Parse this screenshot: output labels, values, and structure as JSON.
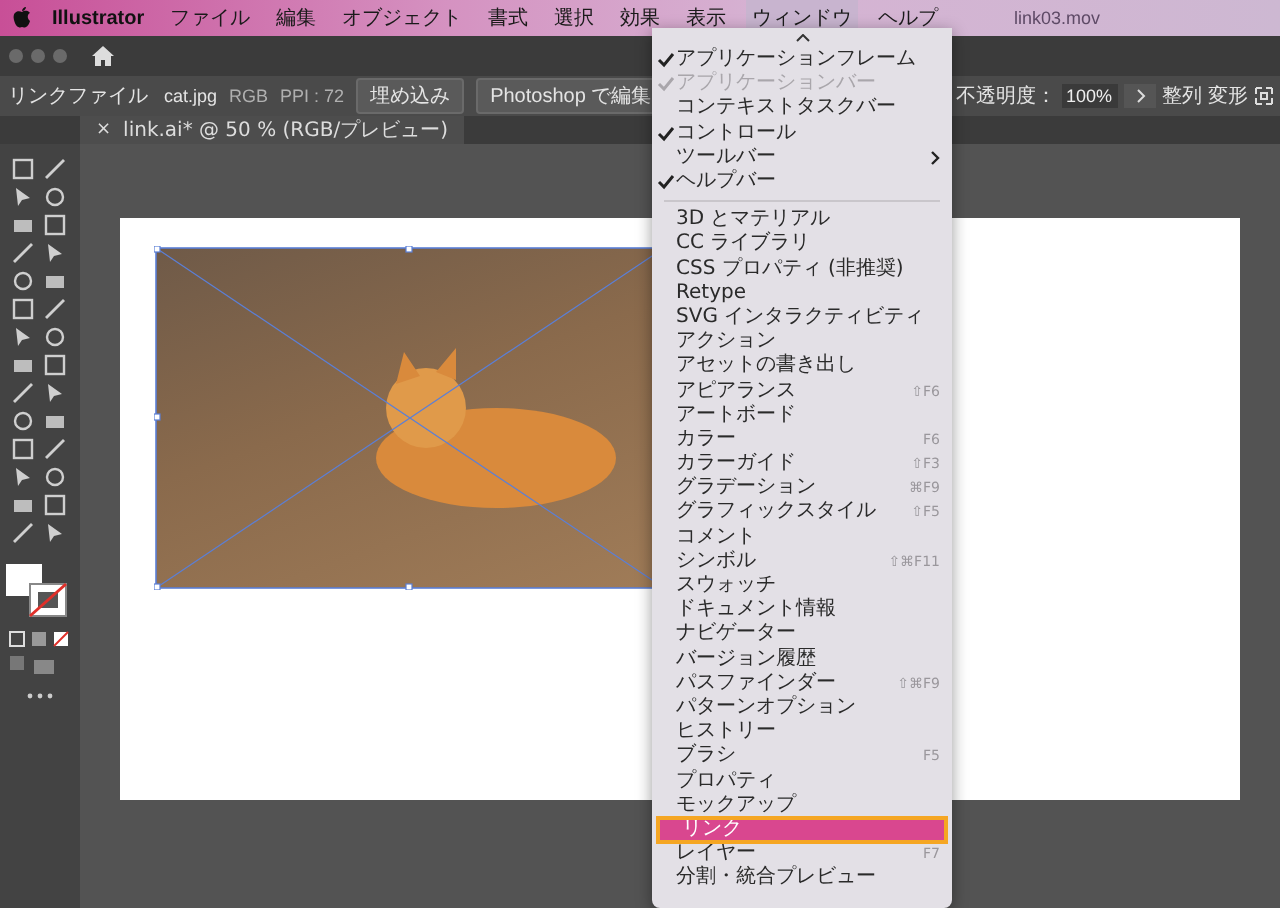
{
  "menubar": {
    "app": "Illustrator",
    "background_title": "link03.mov",
    "menus": [
      {
        "label": "ファイル",
        "selected": false
      },
      {
        "label": "編集",
        "selected": false
      },
      {
        "label": "オブジェクト",
        "selected": false
      },
      {
        "label": "書式",
        "selected": false
      },
      {
        "label": "選択",
        "selected": false
      },
      {
        "label": "効果",
        "selected": false
      },
      {
        "label": "表示",
        "selected": false
      },
      {
        "label": "ウィンドウ",
        "selected": true
      },
      {
        "label": "ヘルプ",
        "selected": false
      }
    ]
  },
  "control_bar": {
    "label": "リンクファイル",
    "file": "cat.jpg",
    "color_mode": "RGB",
    "ppi": "PPI : 72",
    "buttons": [
      "埋め込み",
      "Photoshop で編集"
    ],
    "opacity_label": "不透明度：",
    "opacity_value": "100%",
    "tail_buttons": [
      "整列",
      "変形"
    ]
  },
  "document_tab": {
    "close": "×",
    "title": "link.ai* @ 50 % (RGB/プレビュー)"
  },
  "window_menu": {
    "groups": [
      [
        {
          "label": "アプリケーションフレーム",
          "checked": true,
          "disabled": false,
          "selected": false
        },
        {
          "label": "アプリケーションバー",
          "checked": true,
          "disabled": true,
          "selected": false
        },
        {
          "label": "コンテキストタスクバー",
          "checked": false,
          "disabled": false,
          "selected": false
        },
        {
          "label": "コントロール",
          "checked": true,
          "disabled": false,
          "selected": false
        },
        {
          "label": "ツールバー",
          "checked": false,
          "disabled": false,
          "selected": false,
          "submenu": true
        },
        {
          "label": "ヘルプバー",
          "checked": true,
          "disabled": false,
          "selected": false
        }
      ],
      [
        {
          "label": "3D とマテリアル",
          "checked": false,
          "disabled": false,
          "selected": false
        },
        {
          "label": "CC ライブラリ",
          "checked": false,
          "disabled": false,
          "selected": false
        },
        {
          "label": "CSS プロパティ (非推奨)",
          "checked": false,
          "disabled": false,
          "selected": false
        },
        {
          "label": "Retype",
          "checked": false,
          "disabled": false,
          "selected": false
        },
        {
          "label": "SVG インタラクティビティ",
          "checked": false,
          "disabled": false,
          "selected": false
        },
        {
          "label": "アクション",
          "checked": false,
          "disabled": false,
          "selected": false
        },
        {
          "label": "アセットの書き出し",
          "checked": false,
          "disabled": false,
          "selected": false
        },
        {
          "label": "アピアランス",
          "checked": false,
          "disabled": false,
          "selected": false,
          "shortcut": "⇧F6"
        },
        {
          "label": "アートボード",
          "checked": false,
          "disabled": false,
          "selected": false
        },
        {
          "label": "カラー",
          "checked": false,
          "disabled": false,
          "selected": false,
          "shortcut": "F6"
        },
        {
          "label": "カラーガイド",
          "checked": false,
          "disabled": false,
          "selected": false,
          "shortcut": "⇧F3"
        },
        {
          "label": "グラデーション",
          "checked": false,
          "disabled": false,
          "selected": false,
          "shortcut": "⌘F9"
        },
        {
          "label": "グラフィックスタイル",
          "checked": false,
          "disabled": false,
          "selected": false,
          "shortcut": "⇧F5"
        },
        {
          "label": "コメント",
          "checked": false,
          "disabled": false,
          "selected": false
        },
        {
          "label": "シンボル",
          "checked": false,
          "disabled": false,
          "selected": false,
          "shortcut": "⇧⌘F11"
        },
        {
          "label": "スウォッチ",
          "checked": false,
          "disabled": false,
          "selected": false
        },
        {
          "label": "ドキュメント情報",
          "checked": false,
          "disabled": false,
          "selected": false
        },
        {
          "label": "ナビゲーター",
          "checked": false,
          "disabled": false,
          "selected": false
        },
        {
          "label": "バージョン履歴",
          "checked": false,
          "disabled": false,
          "selected": false
        },
        {
          "label": "パスファインダー",
          "checked": false,
          "disabled": false,
          "selected": false,
          "shortcut": "⇧⌘F9"
        },
        {
          "label": "パターンオプション",
          "checked": false,
          "disabled": false,
          "selected": false
        },
        {
          "label": "ヒストリー",
          "checked": false,
          "disabled": false,
          "selected": false
        },
        {
          "label": "ブラシ",
          "checked": false,
          "disabled": false,
          "selected": false,
          "shortcut": "F5"
        },
        {
          "label": "プロパティ",
          "checked": false,
          "disabled": false,
          "selected": false
        },
        {
          "label": "モックアップ",
          "checked": false,
          "disabled": false,
          "selected": false
        },
        {
          "label": "リンク",
          "checked": false,
          "disabled": false,
          "selected": true
        },
        {
          "label": "レイヤー",
          "checked": false,
          "disabled": false,
          "selected": false,
          "shortcut": "F7"
        },
        {
          "label": "分割・統合プレビュー",
          "checked": false,
          "disabled": false,
          "selected": false
        }
      ]
    ]
  }
}
